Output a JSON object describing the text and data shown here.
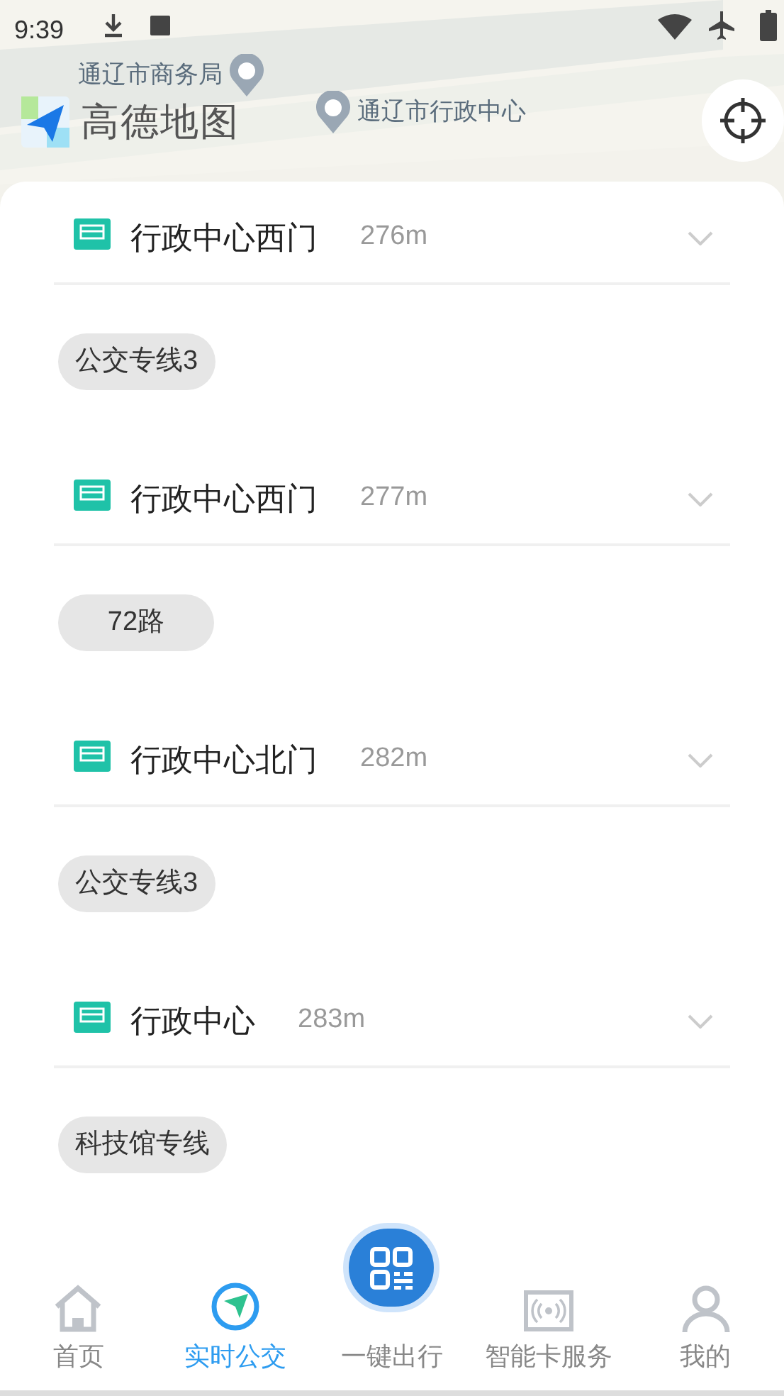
{
  "status_bar": {
    "time": "9:39"
  },
  "map": {
    "labels": [
      {
        "text": "通辽市商务局"
      },
      {
        "text": "通辽市行政中心"
      }
    ],
    "logo": "高德地图"
  },
  "stops": [
    {
      "name": "行政中心西门",
      "distance": "276m",
      "lines": [
        "公交专线3"
      ]
    },
    {
      "name": "行政中心西门",
      "distance": "277m",
      "lines": [
        "72路"
      ]
    },
    {
      "name": "行政中心北门",
      "distance": "282m",
      "lines": [
        "公交专线3"
      ]
    },
    {
      "name": "行政中心",
      "distance": "283m",
      "lines": [
        "科技馆专线"
      ]
    }
  ],
  "nav": [
    {
      "label": "首页",
      "kind": "home",
      "selected": false
    },
    {
      "label": "实时公交",
      "kind": "bus",
      "selected": true
    },
    {
      "label": "一键出行",
      "kind": "qr",
      "selected": false
    },
    {
      "label": "智能卡服务",
      "kind": "card",
      "selected": false
    },
    {
      "label": "我的",
      "kind": "user",
      "selected": false
    }
  ]
}
